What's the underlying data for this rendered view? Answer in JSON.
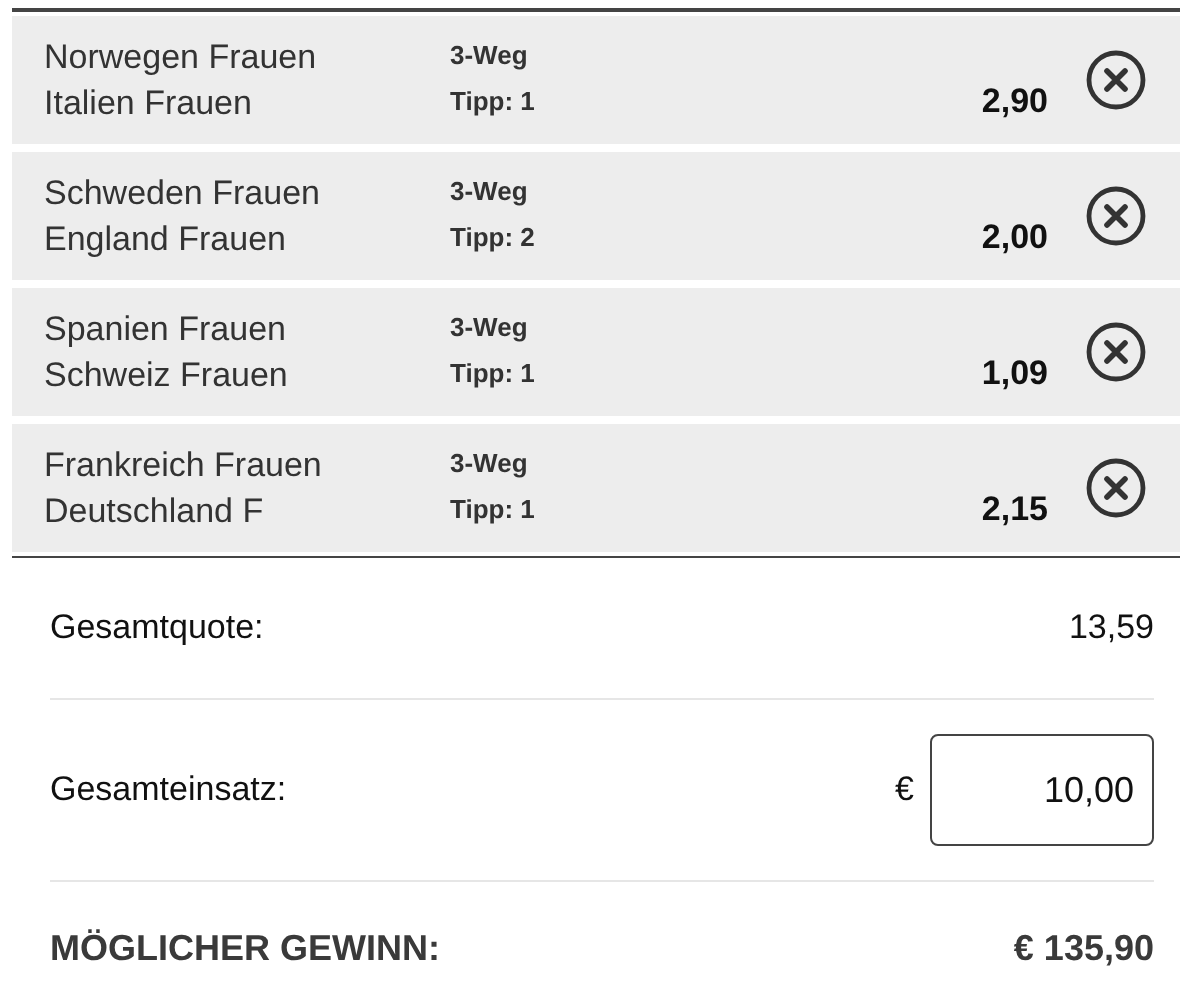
{
  "bets": [
    {
      "home": "Norwegen Frauen",
      "away": "Italien Frauen",
      "market": "3-Weg",
      "tip": "Tipp: 1",
      "odds": "2,90"
    },
    {
      "home": "Schweden Frauen",
      "away": "England Frauen",
      "market": "3-Weg",
      "tip": "Tipp: 2",
      "odds": "2,00"
    },
    {
      "home": "Spanien Frauen",
      "away": "Schweiz Frauen",
      "market": "3-Weg",
      "tip": "Tipp: 1",
      "odds": "1,09"
    },
    {
      "home": "Frankreich Frauen",
      "away": "Deutschland F",
      "market": "3-Weg",
      "tip": "Tipp: 1",
      "odds": "2,15"
    }
  ],
  "summary": {
    "total_odds_label": "Gesamtquote:",
    "total_odds": "13,59",
    "stake_label": "Gesamteinsatz:",
    "currency": "€",
    "stake": "10,00",
    "win_label": "MÖGLICHER GEWINN:",
    "win": "€ 135,90"
  }
}
